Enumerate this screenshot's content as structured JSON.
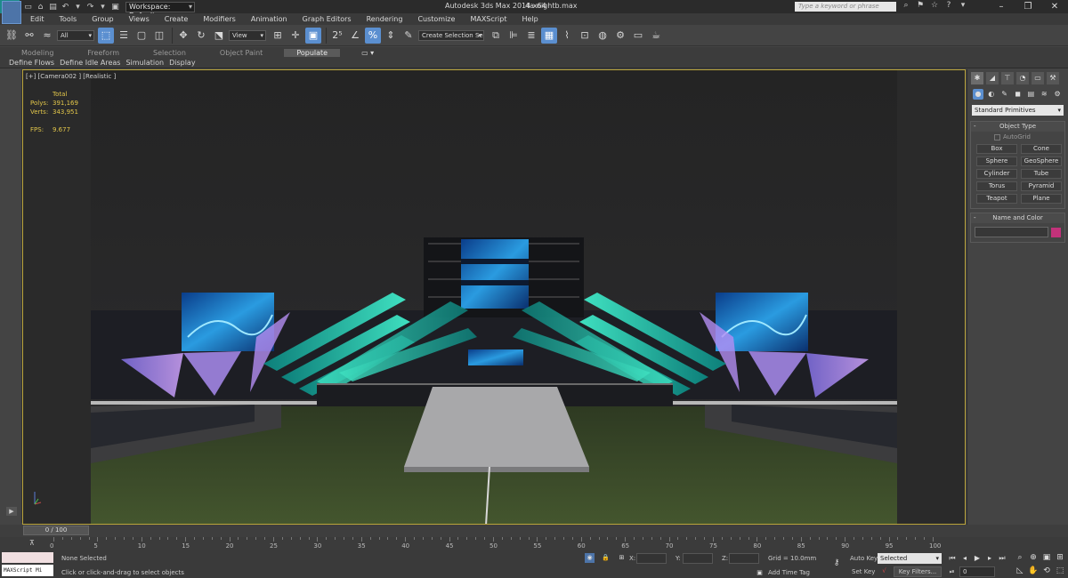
{
  "titlebar": {
    "workspace": "Workspace: Default",
    "app_title": "Autodesk 3ds Max  2014 x64",
    "file_title": "4a-nightb.max",
    "search_placeholder": "Type a keyword or phrase"
  },
  "menu": [
    "Edit",
    "Tools",
    "Group",
    "Views",
    "Create",
    "Modifiers",
    "Animation",
    "Graph Editors",
    "Rendering",
    "Customize",
    "MAXScript",
    "Help"
  ],
  "toolbar": {
    "selection_filter": "All",
    "ref_coord": "View",
    "selection_set": "Create Selection Se"
  },
  "ribbon": {
    "tabs": [
      "Modeling",
      "Freeform",
      "Selection",
      "Object Paint",
      "Populate"
    ],
    "active": "Populate",
    "subtabs": [
      "Define Flows",
      "Define Idle Areas",
      "Simulation",
      "Display"
    ]
  },
  "viewport": {
    "label": "[+] [Camera002 ] [Realistic ]",
    "stats_header": "Total",
    "polys_label": "Polys:",
    "polys": "391,169",
    "verts_label": "Verts:",
    "verts": "343,951",
    "fps_label": "FPS:",
    "fps": "9.677"
  },
  "command_panel": {
    "category": "Standard Primitives",
    "object_type_header": "Object Type",
    "autogrid": "AutoGrid",
    "buttons": [
      "Box",
      "Cone",
      "Sphere",
      "GeoSphere",
      "Cylinder",
      "Tube",
      "Torus",
      "Pyramid",
      "Teapot",
      "Plane"
    ],
    "name_color_header": "Name and Color",
    "color": "#c2327a"
  },
  "timeline": {
    "slider": "0 / 100",
    "ticks": [
      "0",
      "5",
      "10",
      "15",
      "20",
      "25",
      "30",
      "35",
      "40",
      "45",
      "50",
      "55",
      "60",
      "65",
      "70",
      "75",
      "80",
      "85",
      "90",
      "95",
      "100"
    ]
  },
  "status": {
    "maxscript": "MAXScript Mi",
    "selection": "None Selected",
    "prompt": "Click or click-and-drag to select objects",
    "x_label": "X:",
    "y_label": "Y:",
    "z_label": "Z:",
    "grid": "Grid = 10.0mm",
    "add_time_tag": "Add Time Tag",
    "auto_key": "Auto Key",
    "set_key": "Set Key",
    "selected": "Selected",
    "key_filters": "Key Filters...",
    "frame": "0"
  }
}
